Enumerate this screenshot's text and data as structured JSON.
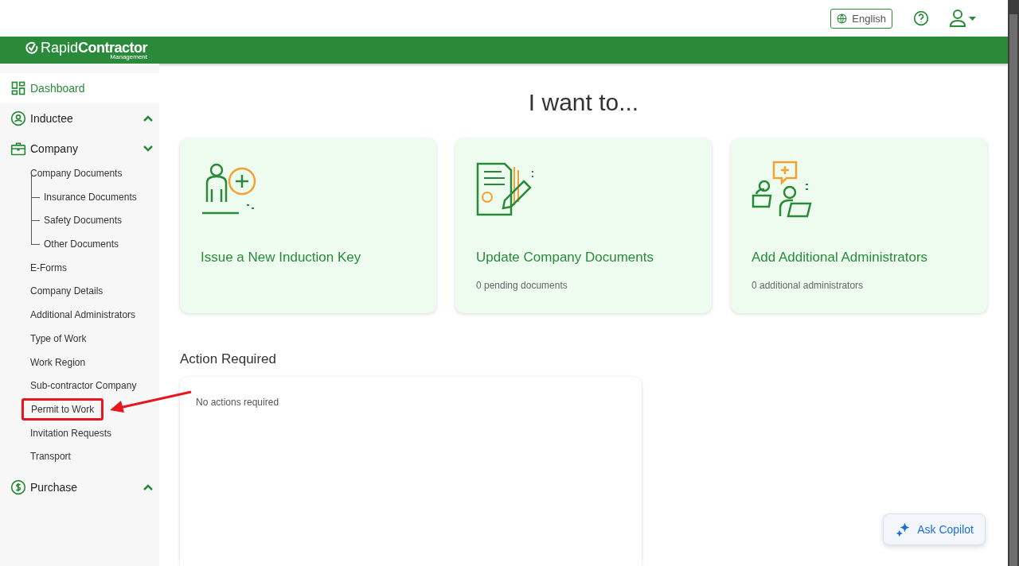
{
  "header": {
    "language": "English"
  },
  "logo": {
    "first": "Rapid",
    "second": "Contractor",
    "sub": "Management"
  },
  "sidebar": {
    "items": [
      {
        "kind": "link",
        "label": "Dashboard",
        "selected": true
      },
      {
        "kind": "group",
        "label": "Inductee",
        "expanded": false
      },
      {
        "kind": "group",
        "label": "Company",
        "expanded": true,
        "children": [
          {
            "label": "Company Documents",
            "highlighted": false,
            "children": [
              {
                "label": "Insurance Documents",
                "highlighted": false
              },
              {
                "label": "Safety Documents",
                "highlighted": false
              },
              {
                "label": "Other Documents",
                "highlighted": false
              }
            ]
          },
          {
            "label": "E-Forms",
            "highlighted": false
          },
          {
            "label": "Company Details",
            "highlighted": false
          },
          {
            "label": "Additional Administrators",
            "highlighted": false
          },
          {
            "label": "Type of Work",
            "highlighted": false
          },
          {
            "label": "Work Region",
            "highlighted": false
          },
          {
            "label": "Sub-contractor Company",
            "highlighted": false
          },
          {
            "label": "Permit to Work",
            "highlighted": true
          },
          {
            "label": "Invitation Requests",
            "highlighted": false
          },
          {
            "label": "Transport",
            "highlighted": false
          }
        ]
      },
      {
        "kind": "group",
        "label": "Purchase",
        "expanded": false
      }
    ]
  },
  "main": {
    "title": "I want to...",
    "cards": [
      {
        "kind": "induction",
        "title": "Issue a New Induction Key"
      },
      {
        "kind": "documents",
        "title": "Update Company Documents",
        "subtitle": "0 pending documents"
      },
      {
        "kind": "admins",
        "title": "Add Additional Administrators",
        "subtitle": "0 additional administrators"
      }
    ],
    "action_required": {
      "heading": "Action Required",
      "message": "No actions required"
    }
  },
  "copilot": {
    "label": "Ask Copilot"
  }
}
